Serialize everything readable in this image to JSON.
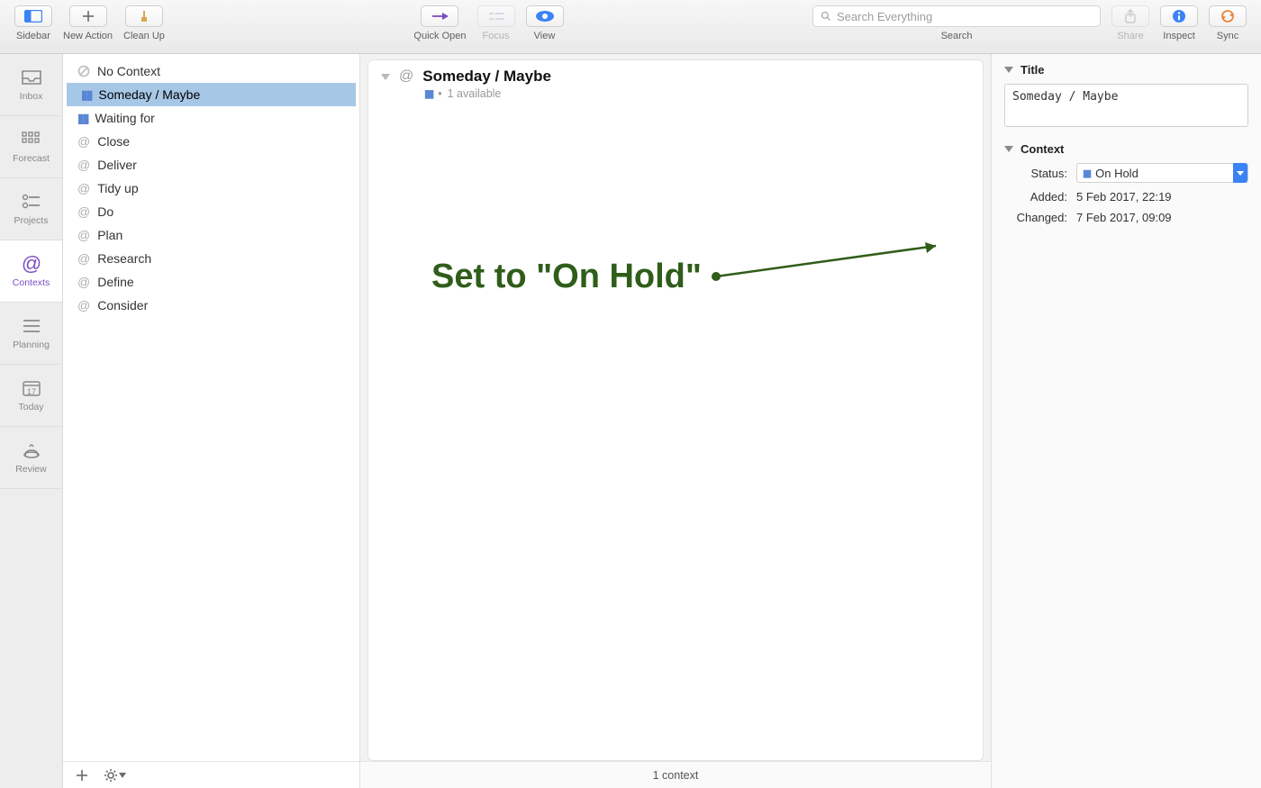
{
  "toolbar": {
    "sidebar": {
      "label": "Sidebar"
    },
    "new_action": {
      "label": "New Action"
    },
    "clean_up": {
      "label": "Clean Up"
    },
    "quick_open": {
      "label": "Quick Open"
    },
    "focus": {
      "label": "Focus"
    },
    "view": {
      "label": "View"
    },
    "search": {
      "label": "Search",
      "placeholder": "Search Everything"
    },
    "share": {
      "label": "Share"
    },
    "inspect": {
      "label": "Inspect"
    },
    "sync": {
      "label": "Sync"
    }
  },
  "perspectives": {
    "items": [
      {
        "label": "Inbox",
        "icon": "inbox"
      },
      {
        "label": "Forecast",
        "icon": "forecast"
      },
      {
        "label": "Projects",
        "icon": "projects"
      },
      {
        "label": "Contexts",
        "icon": "contexts",
        "selected": true
      },
      {
        "label": "Planning",
        "icon": "planning"
      },
      {
        "label": "Today",
        "icon": "today",
        "today_number": "17"
      },
      {
        "label": "Review",
        "icon": "review"
      }
    ]
  },
  "contexts": {
    "items": [
      {
        "label": "No Context",
        "icon": "none"
      },
      {
        "label": "Someday / Maybe",
        "icon": "hold",
        "selected": true
      },
      {
        "label": "Waiting for",
        "icon": "hold"
      },
      {
        "label": "Close",
        "icon": "at"
      },
      {
        "label": "Deliver",
        "icon": "at"
      },
      {
        "label": "Tidy up",
        "icon": "at"
      },
      {
        "label": "Do",
        "icon": "at"
      },
      {
        "label": "Plan",
        "icon": "at"
      },
      {
        "label": "Research",
        "icon": "at"
      },
      {
        "label": "Define",
        "icon": "at"
      },
      {
        "label": "Consider",
        "icon": "at"
      }
    ]
  },
  "detail": {
    "title": "Someday / Maybe",
    "subtitle_count": "1 available",
    "status_text": "1 context"
  },
  "inspector": {
    "title_section_label": "Title",
    "title_value": "Someday / Maybe",
    "context_section_label": "Context",
    "rows": {
      "status_label": "Status:",
      "status_value": "On Hold",
      "added_label": "Added:",
      "added_value": "5 Feb 2017, 22:19",
      "changed_label": "Changed:",
      "changed_value": "7 Feb 2017, 09:09"
    }
  },
  "annotation": {
    "text": "Set to \"On Hold\""
  }
}
